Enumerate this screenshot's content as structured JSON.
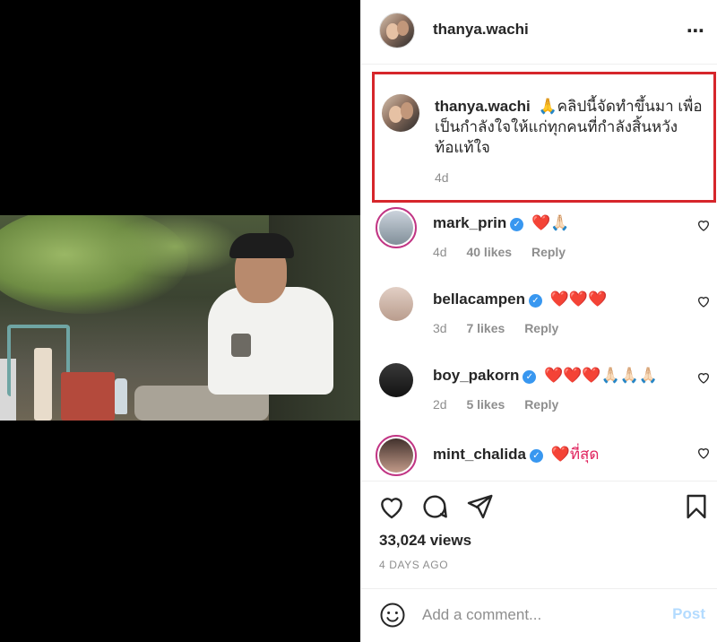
{
  "post": {
    "username": "thanya.wachi",
    "more_icon": "⋯"
  },
  "caption": {
    "username": "thanya.wachi",
    "text": "🙏คลิปนี้จัดทำขึ้นมา เพื่อเป็นกำลังใจให้แก่ทุกคนที่กำลังสิ้นหวัง ท้อแท้ใจ",
    "time": "4d",
    "highlight_color": "#d6262b"
  },
  "comments": [
    {
      "username": "mark_prin",
      "verified": true,
      "body": "❤️🙏🏻",
      "time": "4d",
      "likes": "40 likes",
      "reply": "Reply"
    },
    {
      "username": "bellacampen",
      "verified": true,
      "body": "❤️❤️❤️",
      "time": "3d",
      "likes": "7 likes",
      "reply": "Reply"
    },
    {
      "username": "boy_pakorn",
      "verified": true,
      "body": "❤️❤️❤️🙏🏻🙏🏻🙏🏻",
      "time": "2d",
      "likes": "5 likes",
      "reply": "Reply"
    },
    {
      "username": "mint_chalida",
      "verified": true,
      "body": "❤️ที่สุด"
    }
  ],
  "actions": {
    "icons": [
      "heart-icon",
      "comment-icon",
      "share-icon",
      "bookmark-icon"
    ],
    "views": "33,024 views",
    "time_ago": "4 DAYS AGO"
  },
  "add_comment": {
    "placeholder": "Add a comment...",
    "post_label": "Post",
    "post_color": "#b3dbff"
  },
  "colors": {
    "verified": "#3897f0",
    "meta_text": "#8e8e8e"
  }
}
